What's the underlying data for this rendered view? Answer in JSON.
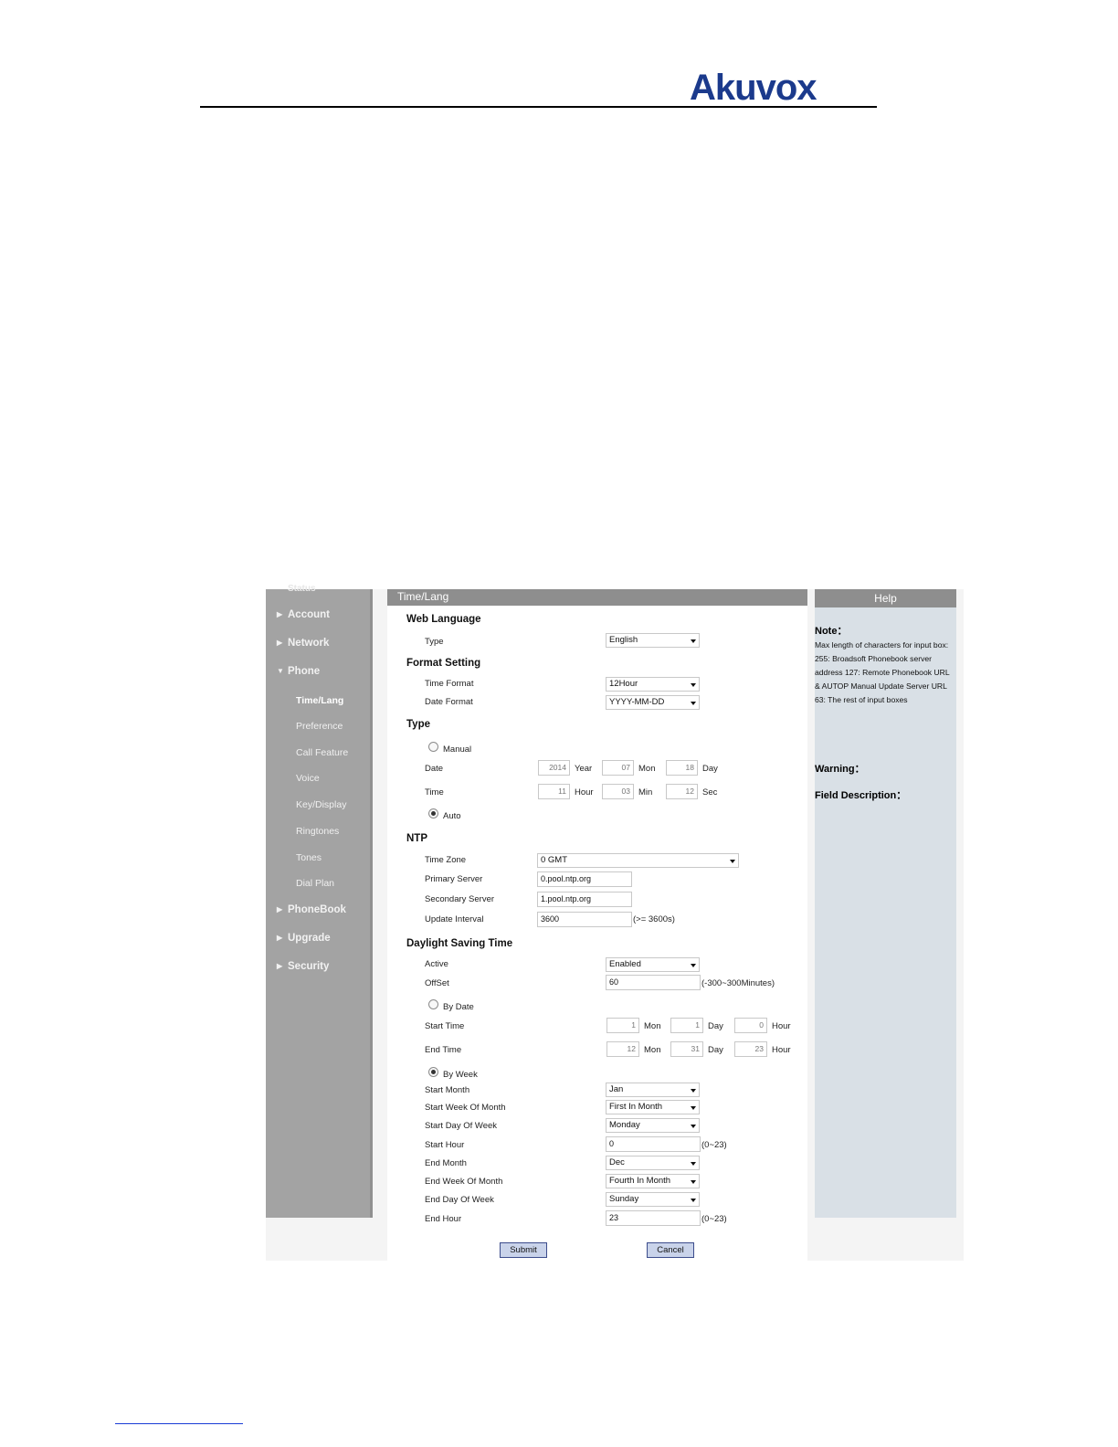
{
  "brand": {
    "logo_text": "Akuvox"
  },
  "sidebar": {
    "cut_item": "Status",
    "items": [
      {
        "label": "Account"
      },
      {
        "label": "Network"
      },
      {
        "label": "Phone"
      },
      {
        "label": "PhoneBook"
      },
      {
        "label": "Upgrade"
      },
      {
        "label": "Security"
      }
    ],
    "phone_sub": [
      {
        "label": "Time/Lang"
      },
      {
        "label": "Preference"
      },
      {
        "label": "Call Feature"
      },
      {
        "label": "Voice"
      },
      {
        "label": "Key/Display"
      },
      {
        "label": "Ringtones"
      },
      {
        "label": "Tones"
      },
      {
        "label": "Dial Plan"
      }
    ],
    "active_sub": "Time/Lang"
  },
  "main": {
    "title": "Time/Lang",
    "web_language": {
      "heading": "Web Language",
      "type_label": "Type",
      "type_value": "English"
    },
    "format": {
      "heading": "Format Setting",
      "time_format_label": "Time Format",
      "time_format_value": "12Hour",
      "date_format_label": "Date Format",
      "date_format_value": "YYYY-MM-DD"
    },
    "type": {
      "heading": "Type",
      "manual_label": "Manual",
      "date_label": "Date",
      "year": "2014",
      "year_unit": "Year",
      "mon": "07",
      "mon_unit": "Mon",
      "day": "18",
      "day_unit": "Day",
      "time_label": "Time",
      "hour": "11",
      "hour_unit": "Hour",
      "min": "03",
      "min_unit": "Min",
      "sec": "12",
      "sec_unit": "Sec",
      "auto_label": "Auto",
      "selected": "Auto"
    },
    "ntp": {
      "heading": "NTP",
      "tz_label": "Time Zone",
      "tz_value": "0 GMT",
      "primary_label": "Primary Server",
      "primary_value": "0.pool.ntp.org",
      "secondary_label": "Secondary Server",
      "secondary_value": "1.pool.ntp.org",
      "interval_label": "Update Interval",
      "interval_value": "3600",
      "interval_hint": "(>= 3600s)"
    },
    "dst": {
      "heading": "Daylight Saving Time",
      "active_label": "Active",
      "active_value": "Enabled",
      "offset_label": "OffSet",
      "offset_value": "60",
      "offset_hint": "(-300~300Minutes)",
      "by_date_label": "By Date",
      "start_time_label": "Start Time",
      "start_mon": "1",
      "start_day": "1",
      "start_hour": "0",
      "end_time_label": "End Time",
      "end_mon": "12",
      "end_day": "31",
      "end_hour": "23",
      "mon_unit": "Mon",
      "day_unit": "Day",
      "hour_unit": "Hour",
      "by_week_label": "By Week",
      "selected": "By Week",
      "start_month_label": "Start Month",
      "start_month_value": "Jan",
      "start_week_label": "Start Week Of Month",
      "start_week_value": "First In Month",
      "start_dow_label": "Start Day Of Week",
      "start_dow_value": "Monday",
      "start_hour_label": "Start Hour",
      "start_hour_value": "0",
      "hour_hint": "(0~23)",
      "end_month_label": "End Month",
      "end_month_value": "Dec",
      "end_week_label": "End Week Of Month",
      "end_week_value": "Fourth In Month",
      "end_dow_label": "End Day Of Week",
      "end_dow_value": "Sunday",
      "end_hour_label": "End Hour",
      "end_hour_value": "23"
    },
    "submit_label": "Submit",
    "cancel_label": "Cancel"
  },
  "help": {
    "title": "Help",
    "note_heading": "Note：",
    "note_text": "Max length of characters for input box: 255: Broadsoft Phonebook server address 127: Remote Phonebook URL & AUTOP Manual Update Server URL 63: The rest of input boxes",
    "warning_heading": "Warning：",
    "field_heading": "Field Description："
  },
  "colors": {
    "brand": "#1b3a8c",
    "sidebar": "#a3a3a3",
    "help_bg": "#d9e0e6",
    "button": "#c9d3ea"
  }
}
